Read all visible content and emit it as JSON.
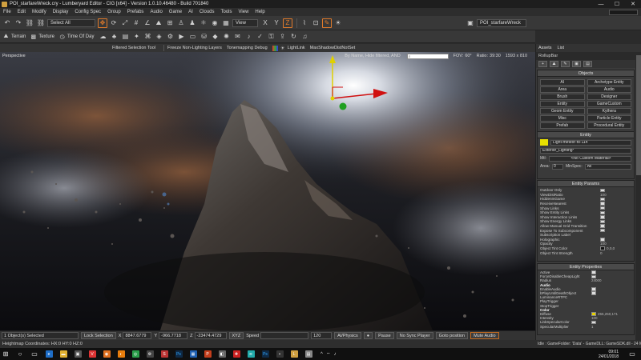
{
  "window": {
    "title": "POI_starfareWreck.cry - Lumberyard Editor - CIG [x64] - Version 1.0.10.46480 - Build 701840",
    "minimize": "—",
    "maximize": "☐",
    "close": "✕"
  },
  "menu": {
    "items": [
      "File",
      "Edit",
      "Modify",
      "Display",
      "Config Spec",
      "Group",
      "Prefabs",
      "Audio",
      "Game",
      "AI",
      "Clouds",
      "Tools",
      "View",
      "Help"
    ]
  },
  "toolbar": {
    "select_mode": "Select All",
    "view_mode": "View",
    "level_name": "POI_starfareWreck"
  },
  "toolbar2": {
    "terrain": "Terrain",
    "texture": "Texture",
    "time_of_day": "Time Of Day"
  },
  "viewport_header": {
    "filtered_selection": "Filtered Selection Tool",
    "freeze_non_lighting": "Freeze Non-Lighting Layers",
    "tonemapping": "Tonemapping Debug",
    "lightlink": "LightLink",
    "maxshadow": "MaxShadowDistNotSet"
  },
  "viewport": {
    "perspective": "Perspective",
    "filter_text": "By Name, Hide filtered, AND",
    "fov_label": "FOV:",
    "fov_value": "60°",
    "ratio_label": "Ratio:",
    "ratio_value": "39:30",
    "resolution": "1593 x 810"
  },
  "bottombar": {
    "selection": "1 Object(s) Selected",
    "lock_selection": "Lock Selection",
    "x_label": "X",
    "x_value": "8847.6779",
    "y_label": "Y",
    "y_value": "-966.7718",
    "z_label": "Z",
    "z_value": "-23474.4729",
    "xyz": "XYZ",
    "speed_label": "Speed",
    "speed_value": "120",
    "ai_physics": "AI/Physics",
    "pause": "Pause",
    "no_sync_player": "No Sync Player",
    "goto_position": "Goto position",
    "mute_audio": "Mute Audio"
  },
  "status": {
    "coords": "Heightmap Coordinates: HX:0 HY:0 HZ:0",
    "right": "Idle : GameFolder: 'Data' - GameDLL: GameSDK.dll - 24 Mb"
  },
  "panel": {
    "tab_assets": "Assets",
    "tab_list": "List",
    "title": "RollupBar",
    "objects_header": "Objects",
    "objects": [
      "AI",
      "Archetype Entity",
      "Area",
      "Audio",
      "Brush",
      "Designer",
      "Entity",
      "GameCustom",
      "Geom Entity",
      "Kythera",
      "Misc",
      "Particle Entity",
      "Prefab",
      "Procedural Entity"
    ],
    "entity_header": "Entity",
    "entity_name": "Light-meteor-f8-114",
    "entity_class": "Exterior_Lighting*",
    "mtl_label": "Mtl:",
    "mtl_value": "<No Custom Material>",
    "area_label": "Area:",
    "area_value": "0",
    "minspec_label": "MinSpec:",
    "minspec_value": "All",
    "params_header": "Entity Params",
    "params": [
      {
        "name": "Outdoor Only",
        "type": "check"
      },
      {
        "name": "ViewDistRatio",
        "type": "text",
        "value": "100"
      },
      {
        "name": "HiddenInGame",
        "type": "check"
      },
      {
        "name": "ReceiveNearest",
        "type": "check"
      },
      {
        "name": "Show Links",
        "type": "check"
      },
      {
        "name": "Show Entity Links",
        "type": "check"
      },
      {
        "name": "Show Interaction Links",
        "type": "check"
      },
      {
        "name": "Show Energy Links",
        "type": "check"
      },
      {
        "name": "Allow Manual Grid Transition",
        "type": "check"
      },
      {
        "name": "Expose To Subcomponent",
        "type": "check"
      },
      {
        "name": "Subscription Label",
        "type": "text",
        "value": ""
      },
      {
        "name": "Holographic",
        "type": "check"
      },
      {
        "name": "Opacity",
        "type": "text",
        "value": "100"
      },
      {
        "name": "Object Tint Color",
        "type": "color",
        "value": "0,0,0"
      },
      {
        "name": "Object Tint Strength",
        "type": "text",
        "value": "0"
      }
    ],
    "props_header": "Entity Properties",
    "props": [
      {
        "name": "Active",
        "type": "check"
      },
      {
        "name": "ForceDisableCheapLight",
        "type": "check"
      },
      {
        "name": "Radius",
        "type": "text",
        "value": "24000"
      },
      {
        "name": "Audio",
        "type": "group"
      },
      {
        "name": "EnableAudio",
        "type": "check"
      },
      {
        "name": "bPlayUntilDeathObject",
        "type": "check"
      },
      {
        "name": "LuminanceRTPC",
        "type": "text",
        "value": ""
      },
      {
        "name": "PlayTrigger",
        "type": "text",
        "value": ""
      },
      {
        "name": "StopTrigger",
        "type": "text",
        "value": ""
      },
      {
        "name": "Color",
        "type": "group"
      },
      {
        "name": "Diffuse",
        "type": "color",
        "value": "255,250,171"
      },
      {
        "name": "Intensity",
        "type": "text",
        "value": "100"
      },
      {
        "name": "LinkSpecularColor",
        "type": "check"
      },
      {
        "name": "SpecularMultiplier",
        "type": "text",
        "value": "1"
      }
    ]
  },
  "taskbar": {
    "time": "09:01",
    "date": "24/01/2018"
  },
  "colors": {
    "accent": "#e07a2a",
    "gizmo_x": "#d01010",
    "gizmo_y": "#e0d000",
    "gizmo_z": "#20a020"
  }
}
